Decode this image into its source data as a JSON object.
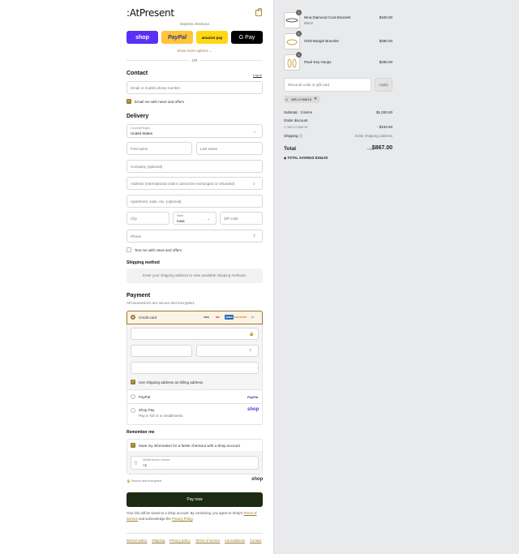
{
  "header": {
    "logo": ":AtPresent"
  },
  "express": {
    "label": "Express checkout",
    "buttons": [
      {
        "label": "shop",
        "bg": "#5a31f4",
        "color": "#ffffff"
      },
      {
        "label": "PayPal",
        "bg": "#ffc439",
        "color": "#253b80"
      },
      {
        "label": "amazon pay",
        "bg": "#ffd814",
        "color": "#111111"
      },
      {
        "label": "G Pay",
        "bg": "#000000",
        "color": "#ffffff"
      }
    ],
    "show_more": "Show more options ⌄",
    "or": "OR"
  },
  "contact": {
    "heading": "Contact",
    "login": "Log in",
    "email_placeholder": "Email or mobile phone number",
    "email_news": "Email me with news and offers"
  },
  "delivery": {
    "heading": "Delivery",
    "country_label": "Country/Region",
    "country_value": "United States",
    "first_name": "First name",
    "last_name": "Last name",
    "company": "Company (optional)",
    "address": "Address (International orders cannot be exchanged or refunded)",
    "apartment": "Apartment, suite, etc. (optional)",
    "city": "City",
    "state_label": "State",
    "state_value": "Iowa",
    "zip": "ZIP code",
    "phone": "Phone",
    "text_news": "Text me with news and offers"
  },
  "shipping": {
    "heading": "Shipping method",
    "placeholder": "Enter your shipping address to view available shipping methods."
  },
  "payment": {
    "heading": "Payment",
    "subtitle": "All transactions are secure and encrypted.",
    "credit_card": "Credit card",
    "cards": [
      "VISA",
      "MC",
      "AMEX",
      "DISCOVER"
    ],
    "more_cards": "+5",
    "billing_same": "Use shipping address as billing address",
    "paypal": "PayPal",
    "paypal_logo": "PayPal",
    "shop_pay": "Shop Pay",
    "shop_pay_sub": "Pay in full or in installments",
    "shop_pay_logo": "shop"
  },
  "remember": {
    "heading": "Remember me",
    "save_info": "Save my information for a faster checkout with a Shop account",
    "mobile_label": "Mobile phone number",
    "mobile_value": "+1",
    "secure": "Secure and encrypted",
    "shop_logo": "shop"
  },
  "pay_now": "Pay now",
  "legal": {
    "text1": "Your info will be saved to a Shop account. By continuing, you agree to Shop's ",
    "terms": "Terms of Service",
    "text2": " and acknowledge the ",
    "privacy": "Privacy Policy",
    "text3": "."
  },
  "footer": [
    "Refund policy",
    "Shipping",
    "Privacy policy",
    "Terms of service",
    "Cancellations",
    "Contact"
  ],
  "cart": {
    "items": [
      {
        "qty": "1",
        "name": "Nina Diamond Cord Bracelet",
        "variant": "Black",
        "price": "$340.00"
      },
      {
        "qty": "1",
        "name": "Orbit Bangle Bracelet",
        "variant": "",
        "price": "$390.00"
      },
      {
        "qty": "1",
        "name": "Pavé Key Hoops",
        "variant": "",
        "price": "$290.00"
      }
    ],
    "discount_placeholder": "Discount code or gift card",
    "apply": "Apply",
    "applied_code": "WELCOME15",
    "subtotal_label": "Subtotal · 3 items",
    "subtotal": "$1,020.00",
    "order_discount_label": "Order discount",
    "discount_code": "WELCOME15",
    "discount_value": "- $153.00",
    "shipping_label": "Shipping",
    "shipping_value": "Enter shipping address",
    "total_label": "Total",
    "currency": "USD",
    "total": "$867.00",
    "savings_label": "TOTAL SAVINGS",
    "savings": "$153.00"
  }
}
